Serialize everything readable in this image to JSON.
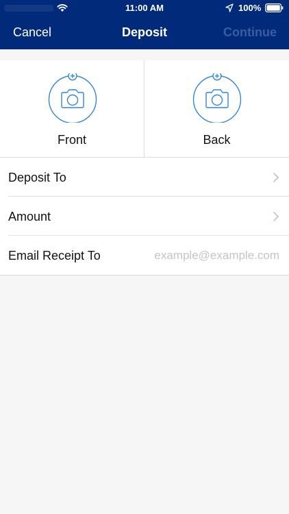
{
  "status_bar": {
    "time": "11:00 AM",
    "battery_percent": "100%",
    "icons": [
      "wifi-icon",
      "location-arrow-icon",
      "battery-icon"
    ]
  },
  "nav": {
    "cancel_label": "Cancel",
    "title": "Deposit",
    "continue_label": "Continue"
  },
  "capture": {
    "front_label": "Front",
    "back_label": "Back",
    "icon": "camera-add-icon"
  },
  "form": {
    "deposit_to_label": "Deposit To",
    "amount_label": "Amount",
    "email_label": "Email Receipt To",
    "email_placeholder": "example@example.com",
    "email_value": ""
  },
  "colors": {
    "nav_background": "#012a7a",
    "accent": "#2f86d6",
    "continue_disabled": "#3a5e9e",
    "page_background": "#f6f6f7"
  }
}
